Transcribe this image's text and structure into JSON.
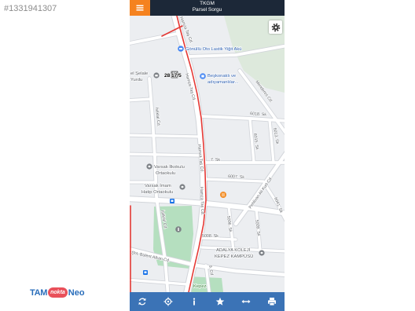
{
  "listing": {
    "number": "#1331941307"
  },
  "watermark": {
    "brand_left": "TAM",
    "brand_mid": "nokta",
    "brand_right": "Neo"
  },
  "app": {
    "header": {
      "menu_icon": "hamburger-icon",
      "title": "TKGM",
      "subtitle": "Parsel Sorgu"
    },
    "settings_icon": "gear-icon",
    "map": {
      "parcel_label": "28 17/5",
      "places": [
        {
          "name": [
            "Gönüllü Oto Lastik Yiğit Akü"
          ],
          "icon": "car-service-pin-icon"
        },
        {
          "name": [
            "Beşkonaklı ve",
            "adıyamanlılar..."
          ],
          "icon": "shop-pin-icon"
        },
        {
          "name": [
            "el Şelale",
            "Yurdu"
          ],
          "icon": "dormitory-pin-icon"
        },
        {
          "name": [
            "Varsak İlkokulu",
            "Ortaokulu"
          ],
          "icon": "school-pin-icon"
        },
        {
          "name": [
            "Varsak İmam",
            "Hatip Ortaokulu"
          ],
          "icon": "school-pin-icon"
        },
        {
          "name": [
            "ADALYA KOLEJİ",
            "KEPEZ KAMPÜSÜ"
          ],
          "icon": "school-pin-icon"
        },
        {
          "name": [
            "Kepez"
          ]
        }
      ],
      "streets": [
        "Hamza Taş Cd.",
        "Hamza Taş Cd.",
        "Hamza Taş Cd.",
        "Hamza Taş Cd.",
        "İstiklal Cd.",
        "İstiklal Cd.",
        "Menderes Cd.",
        "6018. Sk",
        "6015. Sk",
        "6013. Sk",
        "7. Sk",
        "6007. Sk",
        "Pehlivan Ali Kurt Cd.",
        "6041. Sk",
        "5006. Sk",
        "5009. Sk",
        "5008. Sk",
        "Şht. Bülent Alkan Cd.",
        "9. Cd"
      ],
      "other_icons": [
        "restaurant-pin-icon",
        "landmark-pin-icon",
        "bus-stop-icon",
        "bus-stop-icon"
      ]
    },
    "toolbar": [
      {
        "icon": "refresh-icon"
      },
      {
        "icon": "locate-icon"
      },
      {
        "icon": "info-icon"
      },
      {
        "icon": "star-icon"
      },
      {
        "icon": "measure-icon"
      },
      {
        "icon": "print-icon"
      }
    ]
  },
  "colors": {
    "header_bg": "#1c2838",
    "menu_button": "#f5821f",
    "toolbar_bg": "#3b73b6",
    "parcel_outline": "#e53935",
    "park": "#b5dfbf",
    "map_bg": "#eceef1",
    "brand_blue": "#2a6ebb",
    "brand_red": "#e9505a"
  }
}
